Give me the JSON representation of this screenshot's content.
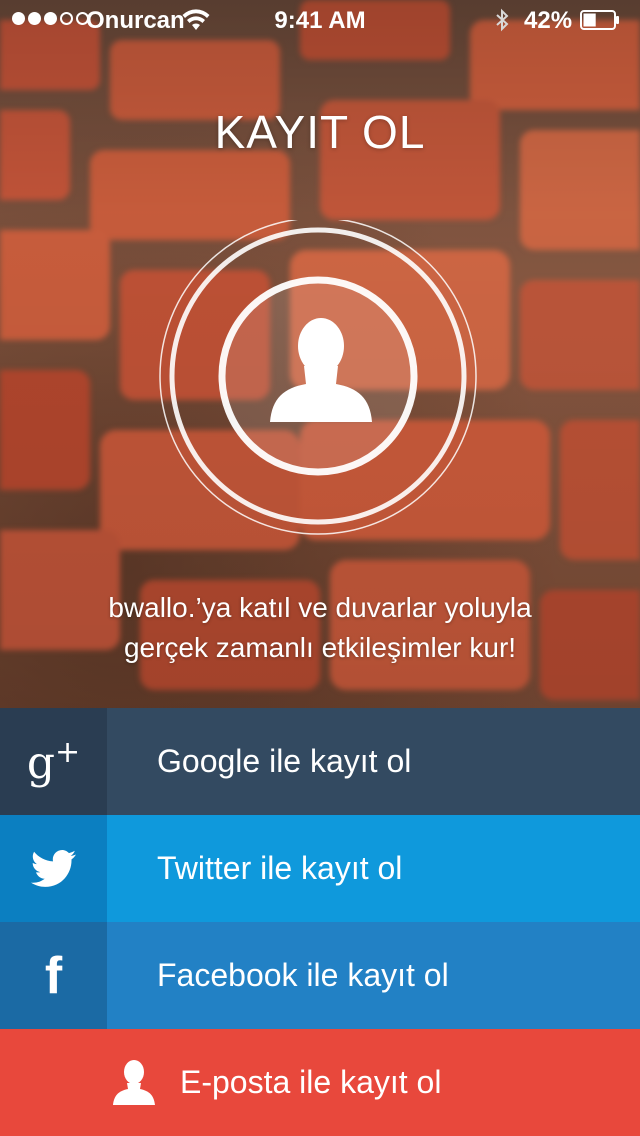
{
  "status_bar": {
    "carrier": "Onurcan",
    "time": "9:41 AM",
    "battery": "42%",
    "signal_bars_filled": 3,
    "signal_bars_total": 5,
    "battery_level": 0.42
  },
  "header": {
    "title": "KAYIT OL"
  },
  "tagline": {
    "line1": "bwallo.’ya katıl ve duvarlar yoluyla",
    "line2": "gerçek zamanlı etkileşimler kur!"
  },
  "signup": {
    "google": {
      "label": "Google ile kayıt ol",
      "icon": "google-plus-icon",
      "icon_text": "g",
      "icon_sup": "+"
    },
    "twitter": {
      "label": "Twitter ile kayıt ol",
      "icon": "twitter-bird-icon"
    },
    "facebook": {
      "label": "Facebook ile kayıt ol",
      "icon": "facebook-icon",
      "icon_text": "f"
    },
    "email": {
      "label": "E-posta ile kayıt ol",
      "icon": "user-icon"
    }
  },
  "colors": {
    "google_bg": "#334a61",
    "twitter_bg": "#0f99dc",
    "facebook_bg": "#2281c5",
    "email_bg": "#e8483c"
  }
}
